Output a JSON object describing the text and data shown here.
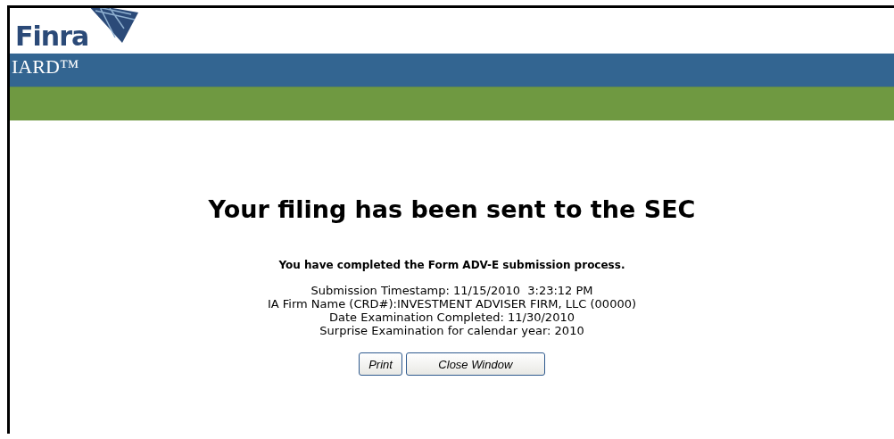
{
  "header": {
    "logo_text": "Finra",
    "product": "IARD™"
  },
  "heading": "Your filing has been sent to the SEC",
  "confirmation": "You have completed the Form ADV-E submission process.",
  "details": [
    "Submission Timestamp: 11/15/2010  3:23:12 PM",
    "IA Firm Name (CRD#):INVESTMENT ADVISER FIRM, LLC (00000)",
    "Date Examination Completed: 11/30/2010",
    "Surprise Examination for calendar year: 2010"
  ],
  "buttons": [
    "Print",
    "Close Window"
  ]
}
